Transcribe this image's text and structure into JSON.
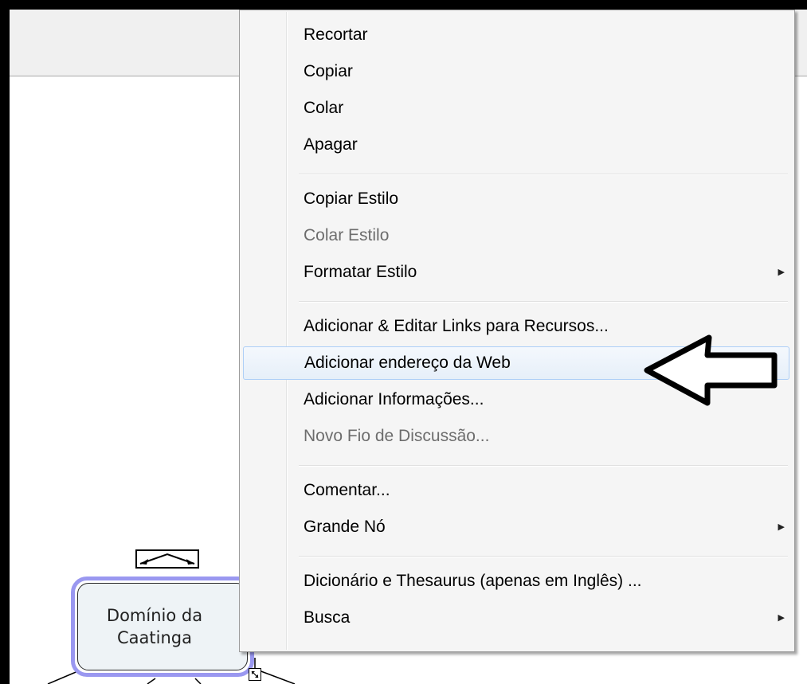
{
  "node": {
    "line1": "Domínio da",
    "line2": "Caatinga"
  },
  "menu": {
    "groups": [
      [
        {
          "label": "Recortar",
          "disabled": false
        },
        {
          "label": "Copiar",
          "disabled": false
        },
        {
          "label": "Colar",
          "disabled": false
        },
        {
          "label": "Apagar",
          "disabled": false
        }
      ],
      [
        {
          "label": "Copiar Estilo",
          "disabled": false
        },
        {
          "label": "Colar Estilo",
          "disabled": true
        },
        {
          "label": "Formatar Estilo",
          "disabled": false,
          "submenu": true
        }
      ],
      [
        {
          "label": "Adicionar & Editar Links para Recursos...",
          "disabled": false
        },
        {
          "label": "Adicionar endereço da Web",
          "disabled": false,
          "highlighted": true
        },
        {
          "label": "Adicionar Informações...",
          "disabled": false
        },
        {
          "label": "Novo Fio de Discussão...",
          "disabled": true
        }
      ],
      [
        {
          "label": "Comentar...",
          "disabled": false
        },
        {
          "label": "Grande Nó",
          "disabled": false,
          "submenu": true
        }
      ],
      [
        {
          "label": "Dicionário e Thesaurus (apenas em Inglês) ...",
          "disabled": false
        },
        {
          "label": "Busca",
          "disabled": false,
          "submenu": true
        }
      ]
    ]
  },
  "icons": {
    "submenu": "submenu-arrow-icon",
    "pointer": "pointing-arrow-icon",
    "expand": "expand-handle-icon",
    "resize": "resize-handle-icon"
  },
  "colors": {
    "node_border": "#9a98f0",
    "node_fill": "#eef3f6",
    "highlight_border": "#aecff7",
    "disabled_text": "#6d6d6d"
  }
}
